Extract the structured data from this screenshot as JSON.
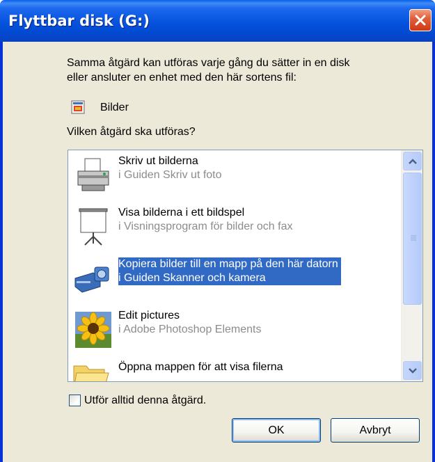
{
  "window": {
    "title": "Flyttbar disk (G:)"
  },
  "dialog": {
    "description": "Samma åtgärd kan utföras varje gång du sätter in en disk\neller ansluter en enhet med den här sortens fil:",
    "content_type": {
      "label": "Bilder",
      "icon": "pictures-icon"
    },
    "question": "Vilken åtgärd ska utföras?"
  },
  "actions": [
    {
      "title": "Skriv ut bilderna",
      "program": "i Guiden Skriv ut foto",
      "icon": "printer-icon",
      "selected": false
    },
    {
      "title": "Visa bilderna i ett bildspel",
      "program": "i Visningsprogram för bilder och fax",
      "icon": "projector-screen-icon",
      "selected": false
    },
    {
      "title": "Kopiera bilder till en mapp på den här datorn",
      "program": "i Guiden Skanner och kamera",
      "icon": "camera-icon",
      "selected": true
    },
    {
      "title": "Edit pictures",
      "program": "i Adobe Photoshop Elements",
      "icon": "sunflower-icon",
      "selected": false
    },
    {
      "title": "Öppna mappen för att visa filerna",
      "program": "",
      "icon": "folder-icon",
      "selected": false
    }
  ],
  "always_checkbox": {
    "label": "Utför alltid denna åtgärd.",
    "checked": false
  },
  "buttons": {
    "ok": "OK",
    "cancel": "Avbryt"
  },
  "colors": {
    "selection": "#316ac5",
    "titlebar": "#0552dd",
    "dialog_bg": "#ece9d8",
    "close": "#e0603c"
  }
}
